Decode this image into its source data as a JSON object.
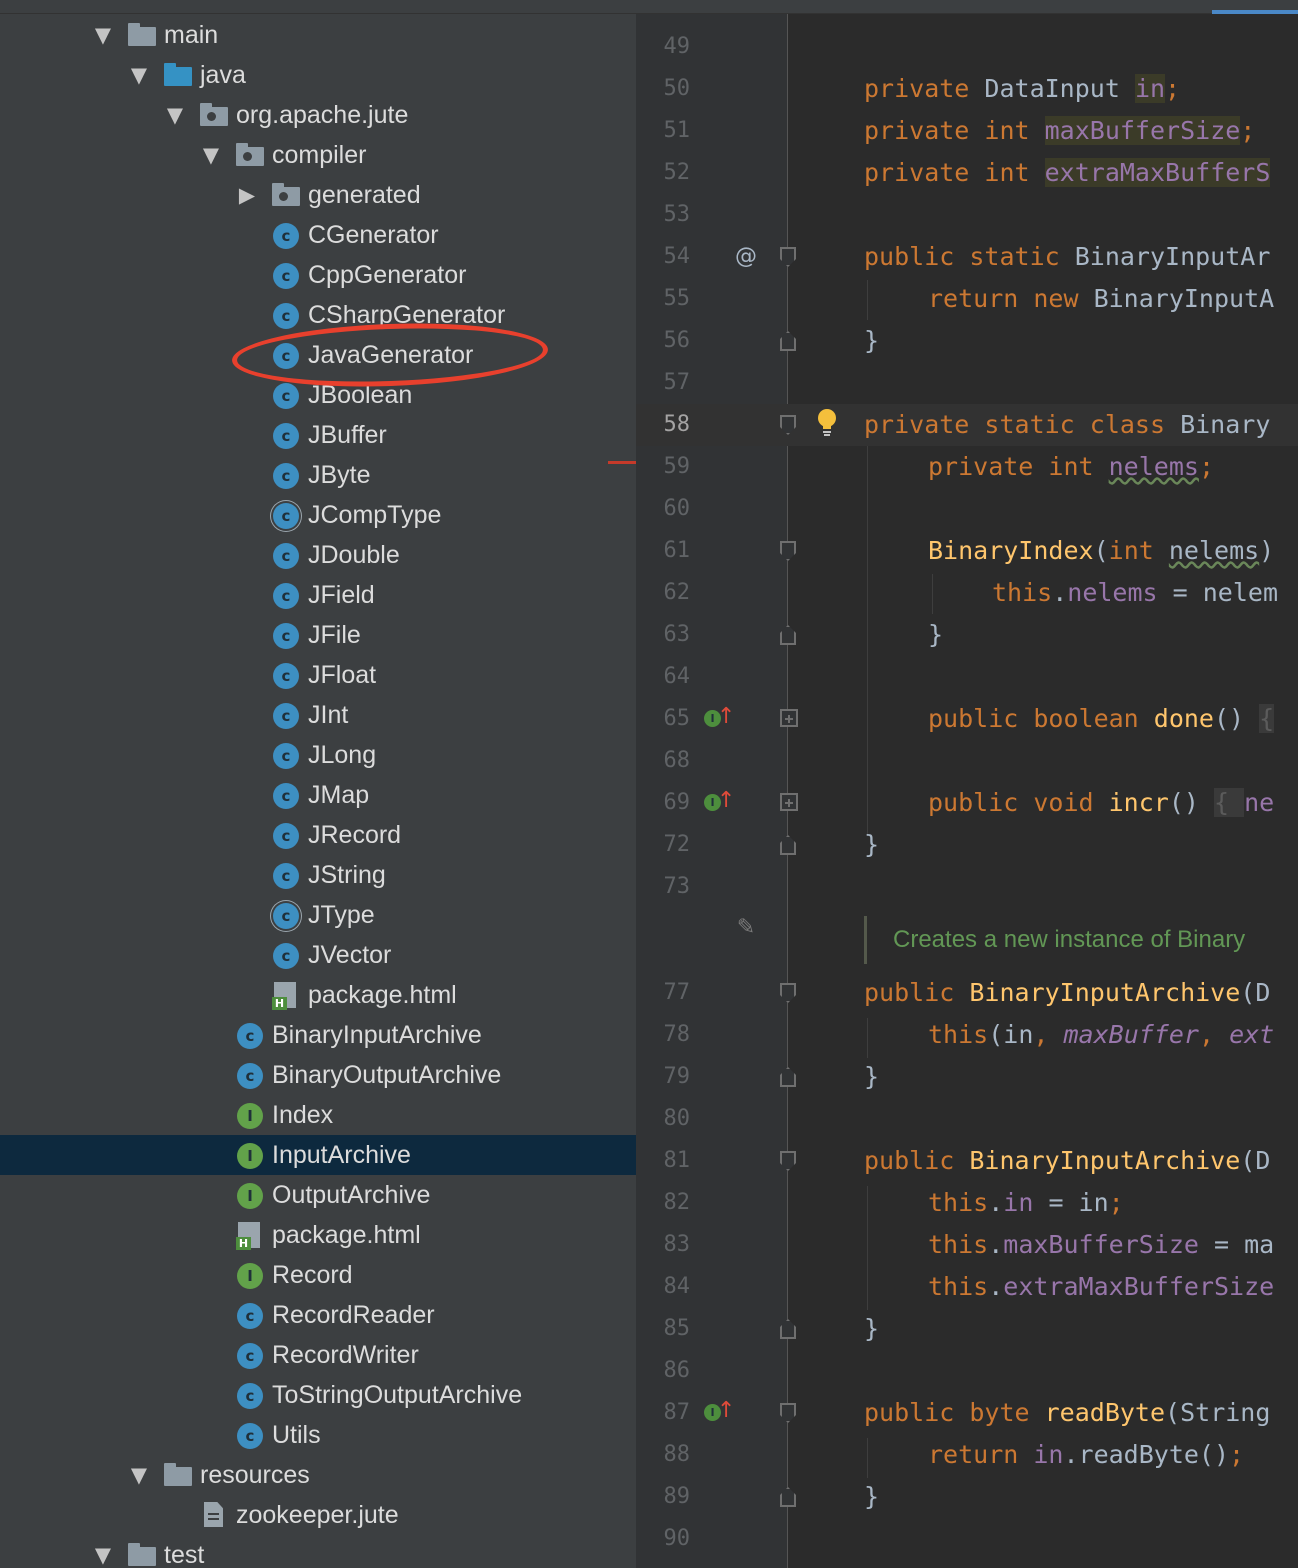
{
  "project_tree": {
    "rows": [
      {
        "label": "main",
        "icon": "folder-icon",
        "arrow": "▼"
      },
      {
        "label": "java",
        "icon": "source-folder-icon",
        "arrow": "▼"
      },
      {
        "label": "org.apache.jute",
        "icon": "package-icon",
        "arrow": "▼"
      },
      {
        "label": "compiler",
        "icon": "package-icon",
        "arrow": "▼"
      },
      {
        "label": "generated",
        "icon": "package-icon",
        "arrow": "▶"
      },
      {
        "label": "CGenerator",
        "icon": "class-icon",
        "arrow": ""
      },
      {
        "label": "CppGenerator",
        "icon": "class-icon",
        "arrow": ""
      },
      {
        "label": "CSharpGenerator",
        "icon": "class-icon",
        "arrow": ""
      },
      {
        "label": "JavaGenerator",
        "icon": "class-icon",
        "arrow": ""
      },
      {
        "label": "JBoolean",
        "icon": "class-icon",
        "arrow": ""
      },
      {
        "label": "JBuffer",
        "icon": "class-icon",
        "arrow": ""
      },
      {
        "label": "JByte",
        "icon": "class-icon",
        "arrow": ""
      },
      {
        "label": "JCompType",
        "icon": "abstract-class-icon",
        "arrow": ""
      },
      {
        "label": "JDouble",
        "icon": "class-icon",
        "arrow": ""
      },
      {
        "label": "JField",
        "icon": "class-icon",
        "arrow": ""
      },
      {
        "label": "JFile",
        "icon": "class-icon",
        "arrow": ""
      },
      {
        "label": "JFloat",
        "icon": "class-icon",
        "arrow": ""
      },
      {
        "label": "JInt",
        "icon": "class-icon",
        "arrow": ""
      },
      {
        "label": "JLong",
        "icon": "class-icon",
        "arrow": ""
      },
      {
        "label": "JMap",
        "icon": "class-icon",
        "arrow": ""
      },
      {
        "label": "JRecord",
        "icon": "class-icon",
        "arrow": ""
      },
      {
        "label": "JString",
        "icon": "class-icon",
        "arrow": ""
      },
      {
        "label": "JType",
        "icon": "abstract-class-icon",
        "arrow": ""
      },
      {
        "label": "JVector",
        "icon": "class-icon",
        "arrow": ""
      },
      {
        "label": "package.html",
        "icon": "html-file-icon",
        "arrow": ""
      },
      {
        "label": "BinaryInputArchive",
        "icon": "class-icon",
        "arrow": ""
      },
      {
        "label": "BinaryOutputArchive",
        "icon": "class-icon",
        "arrow": ""
      },
      {
        "label": "Index",
        "icon": "interface-icon",
        "arrow": ""
      },
      {
        "label": "InputArchive",
        "icon": "interface-icon",
        "arrow": "",
        "selected": true
      },
      {
        "label": "OutputArchive",
        "icon": "interface-icon",
        "arrow": ""
      },
      {
        "label": "package.html",
        "icon": "html-file-icon",
        "arrow": ""
      },
      {
        "label": "Record",
        "icon": "interface-icon",
        "arrow": ""
      },
      {
        "label": "RecordReader",
        "icon": "class-icon",
        "arrow": ""
      },
      {
        "label": "RecordWriter",
        "icon": "class-icon",
        "arrow": ""
      },
      {
        "label": "ToStringOutputArchive",
        "icon": "class-icon",
        "arrow": ""
      },
      {
        "label": "Utils",
        "icon": "class-icon",
        "arrow": ""
      },
      {
        "label": "resources",
        "icon": "folder-icon",
        "arrow": "▼"
      },
      {
        "label": "zookeeper.jute",
        "icon": "text-file-icon",
        "arrow": ""
      },
      {
        "label": "test",
        "icon": "folder-icon",
        "arrow": "▼"
      }
    ],
    "annotation_color": "#e8402d"
  },
  "editor": {
    "line_numbers": [
      "49",
      "50",
      "51",
      "52",
      "53",
      "54",
      "55",
      "56",
      "57",
      "58",
      "59",
      "60",
      "61",
      "62",
      "63",
      "64",
      "65",
      "68",
      "69",
      "72",
      "73",
      "",
      "77",
      "78",
      "79",
      "80",
      "81",
      "82",
      "83",
      "84",
      "85",
      "86",
      "87",
      "88",
      "89",
      "90"
    ],
    "current_line": "58",
    "doc_comment": "Creates a new instance of Binary",
    "gutter_at": "@",
    "colors": {
      "keyword": "#cc7832",
      "field": "#9876aa",
      "method": "#ffc66d",
      "text": "#a9b7c6",
      "comment": "#629755"
    }
  }
}
